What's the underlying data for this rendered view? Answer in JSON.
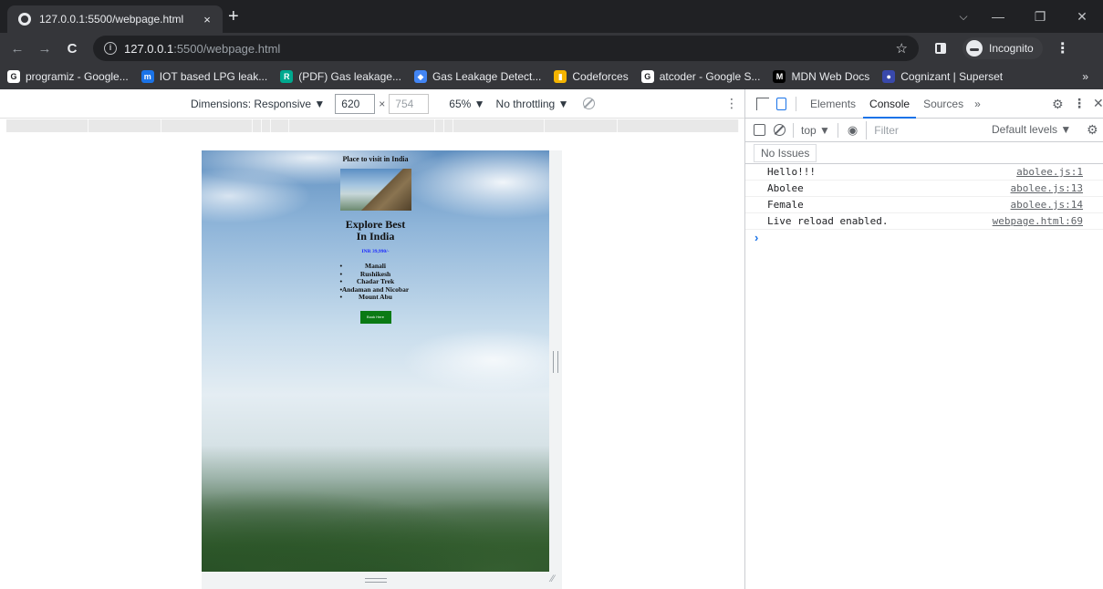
{
  "browser": {
    "tab_title": "127.0.0.1:5500/webpage.html",
    "tab_close": "×",
    "new_tab": "+",
    "window_controls": [
      "⌵",
      "—",
      "❐",
      "✕"
    ],
    "url_host": "127.0.0.1",
    "url_rest": ":5500/webpage.html",
    "star": "☆",
    "incognito": "Incognito",
    "menu": "⋮",
    "nav": {
      "back": "←",
      "forward": "→",
      "reload": "C"
    }
  },
  "bookmarks": [
    {
      "label": "programiz - Google...",
      "color": "#ffffff",
      "icon": "G"
    },
    {
      "label": "IOT based LPG leak...",
      "color": "#1a73e8",
      "icon": "m"
    },
    {
      "label": "(PDF) Gas leakage...",
      "color": "#00a98f",
      "icon": "R"
    },
    {
      "label": "Gas Leakage Detect...",
      "color": "#4285f4",
      "icon": "◆"
    },
    {
      "label": "Codeforces",
      "color": "#f4b400",
      "icon": "▮"
    },
    {
      "label": "atcoder - Google S...",
      "color": "#ffffff",
      "icon": "G"
    },
    {
      "label": "MDN Web Docs",
      "color": "#000000",
      "icon": "M"
    },
    {
      "label": "Cognizant | Superset",
      "color": "#3949ab",
      "icon": "●"
    }
  ],
  "bookmarks_more": "»",
  "device_toolbar": {
    "dimensions": "Dimensions: Responsive ▼",
    "width": "620",
    "x": "×",
    "height": "754",
    "zoom": "65% ▼",
    "throttling": "No throttling ▼",
    "kebab": "⋮"
  },
  "page": {
    "heading": "Place to visit in India",
    "explore_line1": "Explore Best",
    "explore_line2": "In India",
    "price": "INR 39,990/-",
    "places": [
      "Manali",
      "Rushikesh",
      "Chadar Trek",
      "Andaman and Nicobar",
      "Mount Abu"
    ],
    "button": "Book Here"
  },
  "devtools": {
    "tabs": [
      "Elements",
      "Console",
      "Sources"
    ],
    "active_tab": "Console",
    "more": "»",
    "gear": "⚙",
    "kebab": "⋮",
    "close": "✕",
    "context": "top ▼",
    "eye": "◉",
    "filter_placeholder": "Filter",
    "levels": "Default levels ▼",
    "issues": "No Issues",
    "logs": [
      {
        "message": "Hello!!!",
        "source": "abolee.js:1"
      },
      {
        "message": "Abolee",
        "source": "abolee.js:13"
      },
      {
        "message": "Female",
        "source": "abolee.js:14"
      },
      {
        "message": "Live reload enabled.",
        "source": "webpage.html:69"
      }
    ],
    "prompt": "›"
  }
}
